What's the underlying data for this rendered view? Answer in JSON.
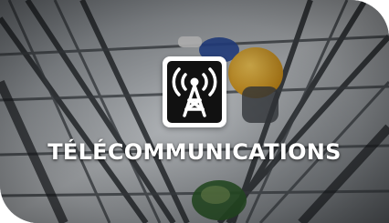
{
  "tile": {
    "title": "TÉLÉCOMMUNICATIONS",
    "icon": "radio-tower-icon",
    "colors": {
      "title_text": "#ffffff",
      "icon_background": "#ffffff",
      "icon_foreground": "#111111",
      "accent_helmet": "#f2b630"
    }
  }
}
